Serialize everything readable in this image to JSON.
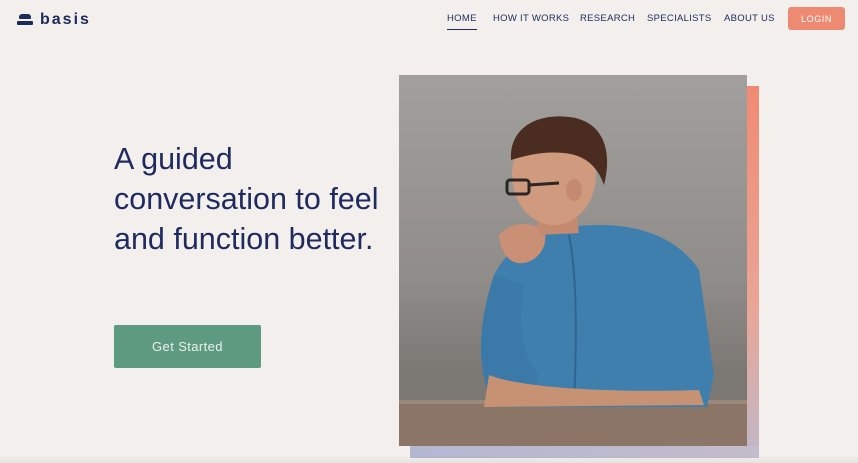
{
  "brand": {
    "name": "basis"
  },
  "nav": {
    "items": [
      {
        "label": "HOME",
        "active": true
      },
      {
        "label": "HOW IT WORKS",
        "active": false
      },
      {
        "label": "RESEARCH",
        "active": false
      },
      {
        "label": "SPECIALISTS",
        "active": false
      },
      {
        "label": "ABOUT US",
        "active": false
      }
    ],
    "login_label": "LOGIN"
  },
  "hero": {
    "headline": "A guided conversation to feel and function better.",
    "cta_label": "Get Started",
    "image_description": "photo-man-in-denim-shirt-leaning-on-table"
  },
  "colors": {
    "navy": "#1d2b5b",
    "login_coral": "#ef8a72",
    "cta_green": "#5e9a7f",
    "background": "#f3efec"
  }
}
